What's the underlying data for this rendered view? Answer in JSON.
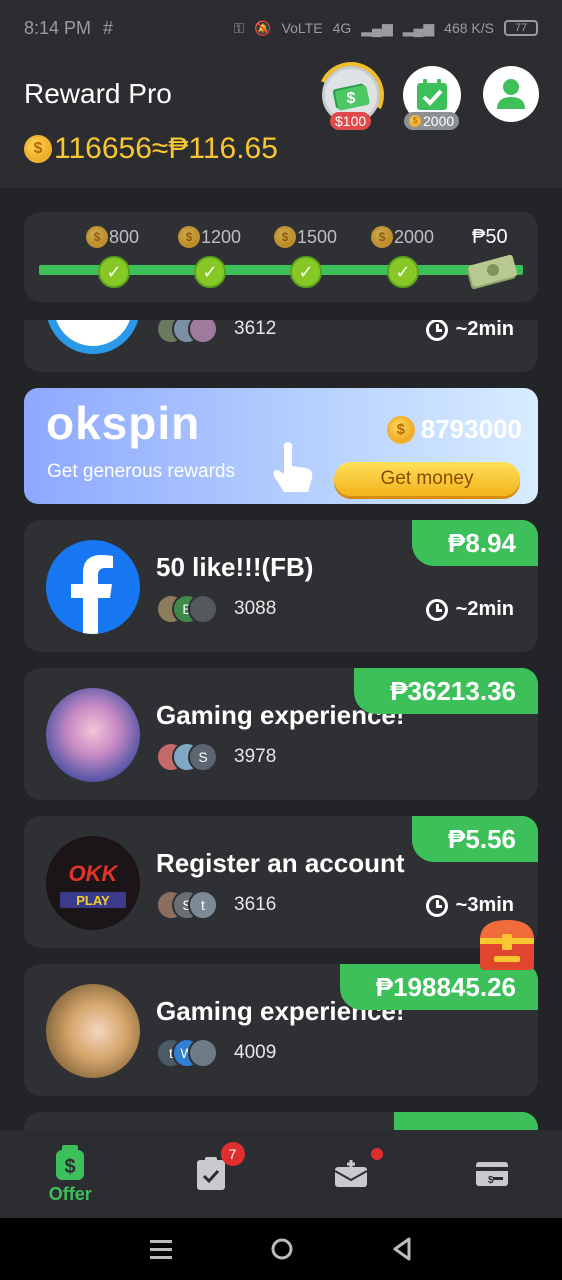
{
  "status_bar": {
    "time": "8:14 PM",
    "indicators": [
      "vpn-key-icon",
      "mute-icon",
      "VoLTE",
      "4G",
      "signal",
      "signal",
      "468 K/S"
    ],
    "battery": "77"
  },
  "header": {
    "title": "Reward Pro",
    "balance_coins": "116656",
    "balance_approx": "≈₱116.65",
    "cash_badge": "$100",
    "task_badge": "2000"
  },
  "progress": {
    "milestones": [
      "800",
      "1200",
      "1500",
      "2000"
    ],
    "final_reward": "₱50",
    "completed": 4
  },
  "partial_card": {
    "count": "3612",
    "duration": "~2min"
  },
  "banner": {
    "logo": "okspin",
    "subtitle": "Get generous rewards",
    "amount": "8793000",
    "button": "Get money"
  },
  "offers": [
    {
      "title": "50 like!!!(FB)",
      "reward": "₱8.94",
      "count": "3088",
      "duration": "~2min",
      "icon": "facebook-icon",
      "avatars": [
        "",
        "B",
        ""
      ]
    },
    {
      "title": "Gaming experience!",
      "reward": "₱36213.36",
      "count": "3978",
      "duration": "",
      "icon": "game-character-icon",
      "avatars": [
        "",
        "",
        "S"
      ]
    },
    {
      "title": "Register an account",
      "reward": "₱5.56",
      "count": "3616",
      "duration": "~3min",
      "icon": "okk-play-icon",
      "avatars": [
        "",
        "S",
        "t"
      ]
    },
    {
      "title": "Gaming experience!",
      "reward": "₱198845.26",
      "count": "4009",
      "duration": "",
      "icon": "game-character-icon",
      "avatars": [
        "t",
        "W",
        ""
      ]
    }
  ],
  "bottom_nav": {
    "items": [
      {
        "label": "Offer",
        "icon": "offer-wallet-icon",
        "active": true
      },
      {
        "label": "",
        "icon": "task-clipboard-icon",
        "badge": "7"
      },
      {
        "label": "",
        "icon": "inbox-icon",
        "dot": true
      },
      {
        "label": "",
        "icon": "cash-card-icon"
      }
    ]
  },
  "colors": {
    "accent_green": "#3dbf5a",
    "gold": "#f7c631",
    "background": "#232427",
    "card": "#2f3034"
  }
}
